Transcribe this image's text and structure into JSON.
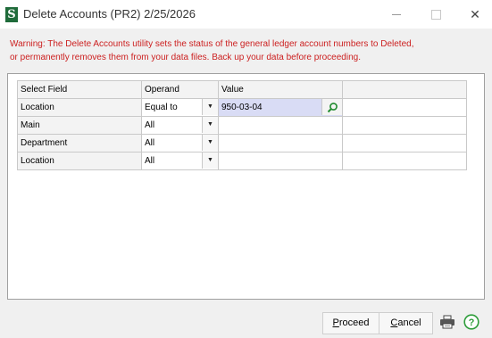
{
  "window": {
    "app_icon_letter": "S",
    "title": "Delete Accounts (PR2) 2/25/2026",
    "close_glyph": "✕"
  },
  "warning_lines": [
    "Warning: The Delete Accounts utility sets the status of the general ledger account numbers to Deleted,",
    "or permanently removes them from your data files. Back up your data before proceeding."
  ],
  "grid": {
    "columns": [
      "Select Field",
      "Operand",
      "Value",
      ""
    ],
    "rows": [
      {
        "field": "Location",
        "operand": "Equal to",
        "value": "950-03-04"
      },
      {
        "field": "Main",
        "operand": "All",
        "value": ""
      },
      {
        "field": "Department",
        "operand": "All",
        "value": ""
      },
      {
        "field": "Location",
        "operand": "All",
        "value": ""
      }
    ]
  },
  "buttons": {
    "proceed_label": "Proceed",
    "proceed_mnemonic": "P",
    "proceed_rest": "roceed",
    "cancel_label": "Cancel",
    "cancel_mnemonic": "C",
    "cancel_rest": "ancel"
  },
  "icons": {
    "app": "sage-app-icon",
    "lookup": "magnifier-icon",
    "dropdown": "chevron-down-icon",
    "print": "printer-icon",
    "help": "help-icon"
  },
  "colors": {
    "warning": "#cc1f1f",
    "app_icon_bg": "#1f6b3a",
    "selected_cell": "#d9dcf5",
    "help_green": "#2e9d3a"
  }
}
